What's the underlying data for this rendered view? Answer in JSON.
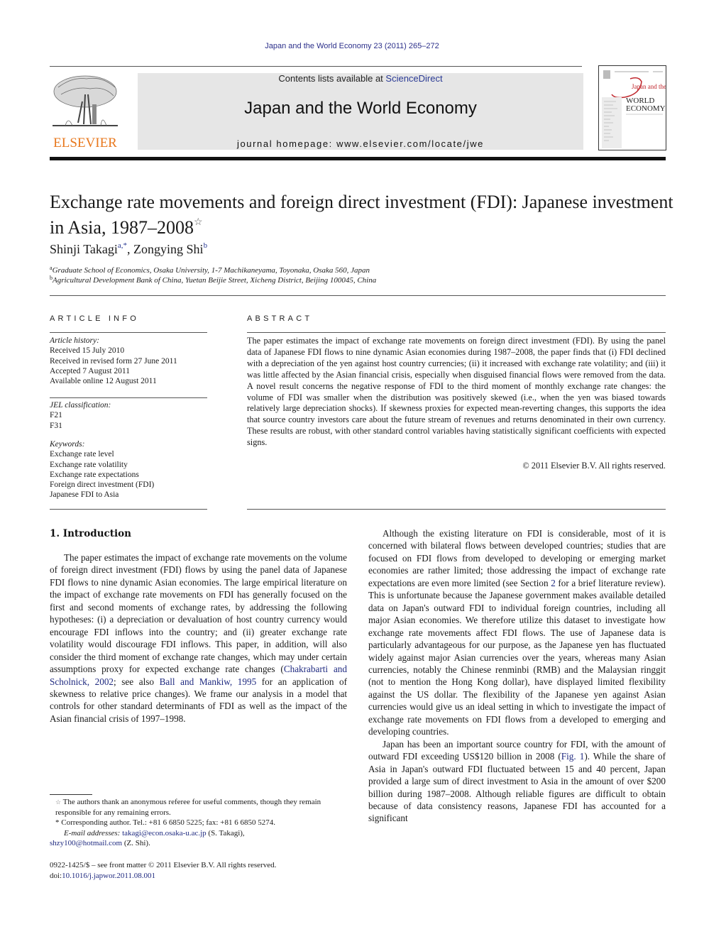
{
  "journal_ref": "Japan and the World Economy 23 (2011) 265–272",
  "masthead": {
    "contents_prefix": "Contents lists available at ",
    "contents_link": "ScienceDirect",
    "journal_title": "Japan and the World Economy",
    "homepage": "journal homepage: www.elsevier.com/locate/jwe",
    "publisher": "ELSEVIER",
    "cover_title_line1": "Japan and the",
    "cover_title_line2": "WORLD",
    "cover_title_line3": "ECONOMY"
  },
  "colors": {
    "link": "#1f2a80",
    "elsevier_orange": "#e8781e",
    "masthead_bg": "#e6e6e6",
    "cover_accent": "#c0272d"
  },
  "article": {
    "title": "Exchange rate movements and foreign direct investment (FDI): Japanese investment in Asia, 1987–2008",
    "title_mark": "☆",
    "authors": [
      {
        "name": "Shinji Takagi",
        "marks": "a,*"
      },
      {
        "name": "Zongying Shi",
        "marks": "b"
      }
    ],
    "author_separator": ", ",
    "affiliations": [
      {
        "mark": "a",
        "text": "Graduate School of Economics, Osaka University, 1-7 Machikaneyama, Toyonaka, Osaka 560, Japan"
      },
      {
        "mark": "b",
        "text": "Agricultural Development Bank of China, Yuetan Beijie Street, Xicheng District, Beijing 100045, China"
      }
    ]
  },
  "article_info": {
    "label": "ARTICLE INFO",
    "history_heading": "Article history:",
    "history": [
      "Received 15 July 2010",
      "Received in revised form 27 June 2011",
      "Accepted 7 August 2011",
      "Available online 12 August 2011"
    ],
    "jel_heading": "JEL classification:",
    "jel": [
      "F21",
      "F31"
    ],
    "keywords_heading": "Keywords:",
    "keywords": [
      "Exchange rate level",
      "Exchange rate volatility",
      "Exchange rate expectations",
      "Foreign direct investment (FDI)",
      "Japanese FDI to Asia"
    ]
  },
  "abstract": {
    "label": "ABSTRACT",
    "text": "The paper estimates the impact of exchange rate movements on foreign direct investment (FDI). By using the panel data of Japanese FDI flows to nine dynamic Asian economies during 1987–2008, the paper finds that (i) FDI declined with a depreciation of the yen against host country currencies; (ii) it increased with exchange rate volatility; and (iii) it was little affected by the Asian financial crisis, especially when disguised financial flows were removed from the data. A novel result concerns the negative response of FDI to the third moment of monthly exchange rate changes: the volume of FDI was smaller when the distribution was positively skewed (i.e., when the yen was biased towards relatively large depreciation shocks). If skewness proxies for expected mean-reverting changes, this supports the idea that source country investors care about the future stream of revenues and returns denominated in their own currency. These results are robust, with other standard control variables having statistically significant coefficients with expected signs.",
    "copyright": "© 2011 Elsevier B.V. All rights reserved."
  },
  "intro": {
    "heading": "1. Introduction",
    "p1_a": "The paper estimates the impact of exchange rate movements on the volume of foreign direct investment (FDI) flows by using the panel data of Japanese FDI flows to nine dynamic Asian economies. The large empirical literature on the impact of exchange rate movements on FDI has generally focused on the first and second moments of exchange rates, by addressing the following hypotheses: (i) a depreciation or devaluation of host country currency would encourage FDI inflows into the country; and (ii) greater exchange rate volatility would discourage FDI inflows. This paper, in addition, will also consider the third moment of exchange rate changes, which may under certain assumptions proxy for expected exchange rate changes (",
    "p1_link1": "Chakrabarti and Scholnick, 2002",
    "p1_b": "; see also ",
    "p1_link2": "Ball and Mankiw, 1995",
    "p1_c": " for an application of skewness to relative price changes). We frame our analysis in a model that controls for other standard determinants of FDI as well as the impact of the Asian financial crisis of 1997–1998.",
    "p2_a": "Although the existing literature on FDI is considerable, most of it is concerned with bilateral flows between developed countries; studies that are focused on FDI flows from developed to developing or emerging market economies are rather limited; those addressing the impact of exchange rate expectations are even more limited (see Section ",
    "p2_link": "2",
    "p2_b": " for a brief literature review). This is unfortunate because the Japanese government makes available detailed data on Japan's outward FDI to individual foreign countries, including all major Asian economies. We therefore utilize this dataset to investigate how exchange rate movements affect FDI flows. The use of Japanese data is particularly advantageous for our purpose, as the Japanese yen has fluctuated widely against major Asian currencies over the years, whereas many Asian currencies, notably the Chinese renminbi (RMB) and the Malaysian ringgit (not to mention the Hong Kong dollar), have displayed limited flexibility against the US dollar. The flexibility of the Japanese yen against Asian currencies would give us an ideal setting in which to investigate the impact of exchange rate movements on FDI flows from a developed to emerging and developing countries.",
    "p3_a": "Japan has been an important source country for FDI, with the amount of outward FDI exceeding US$120 billion in 2008 (",
    "p3_link": "Fig. 1",
    "p3_b": "). While the share of Asia in Japan's outward FDI fluctuated between 15 and 40 percent, Japan provided a large sum of direct investment to Asia in the amount of over $200 billion during 1987–2008. Although reliable figures are difficult to obtain because of data consistency reasons, Japanese FDI has accounted for a significant"
  },
  "footnotes": {
    "star_mark": "☆",
    "star_text": " The authors thank an anonymous referee for useful comments, though they remain responsible for any remaining errors.",
    "corr_mark": "*",
    "corr_text": " Corresponding author. Tel.: +81 6 6850 5225; fax: +81 6 6850 5274.",
    "email_label": "E-mail addresses:",
    "email1": "takagi@econ.osaka-u.ac.jp",
    "email1_owner": " (S. Takagi),",
    "email2": "shzy100@hotmail.com",
    "email2_owner": " (Z. Shi)."
  },
  "front_matter": {
    "issn_line": "0922-1425/$ – see front matter © 2011 Elsevier B.V. All rights reserved.",
    "doi_prefix": "doi:",
    "doi": "10.1016/j.japwor.2011.08.001"
  }
}
